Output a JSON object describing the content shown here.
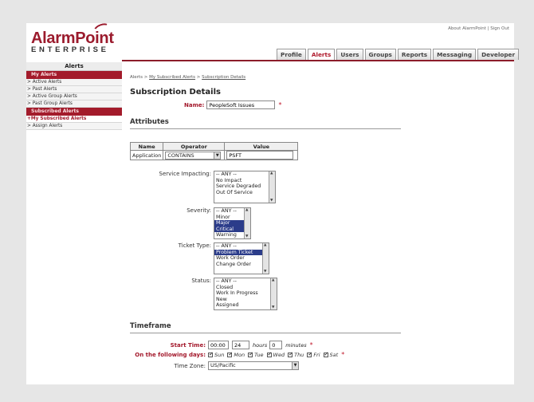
{
  "header": {
    "logo_main": "AlarmPoint",
    "logo_sub": "ENTERPRISE",
    "top_links": [
      "About AlarmPoint",
      "Sign Out"
    ],
    "tabs": [
      {
        "label": "Profile",
        "active": false
      },
      {
        "label": "Alerts",
        "active": true
      },
      {
        "label": "Users",
        "active": false
      },
      {
        "label": "Groups",
        "active": false
      },
      {
        "label": "Reports",
        "active": false
      },
      {
        "label": "Messaging",
        "active": false
      },
      {
        "label": "Developer",
        "active": false
      }
    ]
  },
  "sidebar": {
    "title": "Alerts",
    "my_alerts_header": "My Alerts",
    "my_alerts_items": [
      "> Active Alerts",
      "> Past Alerts",
      "> Active Group Alerts",
      "> Past Group Alerts"
    ],
    "subscribed_header": "Subscribed Alerts",
    "subscribed_items": [
      "+My Subscribed Alerts",
      "> Assign Alerts"
    ]
  },
  "main": {
    "breadcrumb": {
      "part1": "Alerts",
      "sep": " > ",
      "part2": "My Subscribed Alerts",
      "part3": "Subscription Details"
    },
    "title": "Subscription Details",
    "name_label": "Name:",
    "name_value": "PeopleSoft Issues",
    "required_mark": "*",
    "attributes_heading": "Attributes",
    "table": {
      "headers": [
        "Name",
        "Operator",
        "Value"
      ],
      "row": {
        "name": "Application",
        "operator": "CONTAINS",
        "value": "PSFT"
      }
    },
    "service_impacting": {
      "label": "Service Impacting:",
      "options": [
        "-- ANY --",
        "No Impact",
        "Service Degraded",
        "Out Of Service"
      ]
    },
    "severity": {
      "label": "Severity:",
      "options": [
        "-- ANY --",
        "Minor",
        "Major",
        "Critical",
        "Warning"
      ],
      "selected": [
        "Major",
        "Critical"
      ]
    },
    "ticket_type": {
      "label": "Ticket Type:",
      "options": [
        "-- ANY --",
        "Problem Ticket",
        "Work Order",
        "Change Order"
      ],
      "selected": [
        "Problem Ticket"
      ]
    },
    "status": {
      "label": "Status:",
      "options": [
        "-- ANY --",
        "Closed",
        "Work In Progress",
        "New",
        "Assigned"
      ]
    },
    "timeframe_heading": "Timeframe",
    "start_time": {
      "label": "Start Time:",
      "value": "00:00",
      "hours": "24",
      "hours_text": "hours",
      "minutes": "0",
      "minutes_text": "minutes"
    },
    "days": {
      "label": "On the following days:",
      "items": [
        "Sun",
        "Mon",
        "Tue",
        "Wed",
        "Thu",
        "Fri",
        "Sat"
      ]
    },
    "time_zone": {
      "label": "Time Zone:",
      "value": "US/Pacific"
    }
  },
  "colors": {
    "brand": "#9b1b2d",
    "background": "#e6e6e6",
    "selected_option": "#2b3c8a"
  }
}
